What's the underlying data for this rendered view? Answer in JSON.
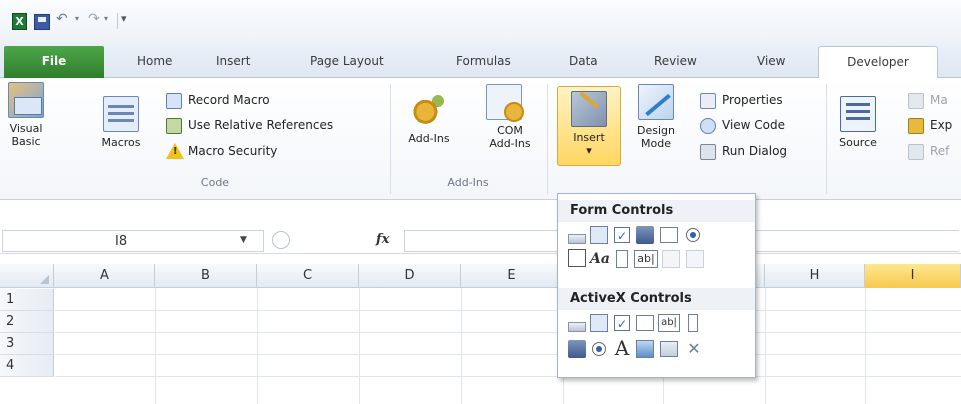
{
  "qat": {
    "app_icon": "excel-icon",
    "save_icon": "save-icon",
    "undo_icon": "undo-icon",
    "redo_icon": "redo-icon",
    "customize_icon": "customize-qat-icon"
  },
  "tabs": {
    "file": "File",
    "home": "Home",
    "insert": "Insert",
    "page_layout": "Page Layout",
    "formulas": "Formulas",
    "data": "Data",
    "review": "Review",
    "view": "View",
    "developer": "Developer",
    "active": "Developer"
  },
  "ribbon": {
    "code_group": {
      "label": "Code",
      "visual_basic": "Visual Basic",
      "macros": "Macros",
      "record_macro": "Record Macro",
      "use_relative_references": "Use Relative References",
      "macro_security": "Macro Security"
    },
    "addins_group": {
      "label": "Add-Ins",
      "add_ins": "Add-Ins",
      "com_add_ins_line1": "COM",
      "com_add_ins_line2": "Add-Ins"
    },
    "controls_group": {
      "insert": "Insert",
      "insert_arrow": "▾",
      "design_mode_line1": "Design",
      "design_mode_line2": "Mode",
      "properties": "Properties",
      "view_code": "View Code",
      "run_dialog": "Run Dialog"
    },
    "xml_group": {
      "source": "Source",
      "map_properties_partial": "Ma",
      "expansion_packs_partial": "Exp",
      "refresh_data_partial": "Ref"
    }
  },
  "formula_bar": {
    "name_box_value": "I8",
    "fx_label": "fx",
    "formula_value": ""
  },
  "grid": {
    "columns": [
      "A",
      "B",
      "C",
      "D",
      "E",
      "",
      "",
      "H",
      "I"
    ],
    "rows": [
      "1",
      "2",
      "3",
      "4"
    ],
    "selected_column": "I"
  },
  "insert_menu": {
    "form_controls_heading": "Form Controls",
    "activex_controls_heading": "ActiveX Controls",
    "form_controls_row1": [
      "button-icon",
      "combo-box-icon",
      "check-box-icon",
      "spin-button-icon",
      "list-box-icon",
      "option-button-icon"
    ],
    "form_controls_row2": [
      "group-box-icon",
      "label-icon",
      "scroll-bar-icon",
      "text-field-icon",
      "combo-list-edit-icon",
      "combo-drop-down-edit-icon"
    ],
    "activex_row1": [
      "command-button-icon",
      "combo-box-icon",
      "check-box-icon",
      "list-box-icon",
      "text-box-icon",
      "scroll-bar-icon"
    ],
    "activex_row2": [
      "spin-button-icon",
      "option-button-icon",
      "label-icon",
      "image-icon",
      "toggle-button-icon",
      "more-controls-icon"
    ],
    "label_glyph": "Aa",
    "text_glyph": "ab|",
    "activex_label_glyph": "A",
    "check_glyph": "✓"
  },
  "colors": {
    "file_tab": "#2f7d2c",
    "selected_column_header": "#f6c94b",
    "insert_button_highlight": "#ffd661"
  }
}
